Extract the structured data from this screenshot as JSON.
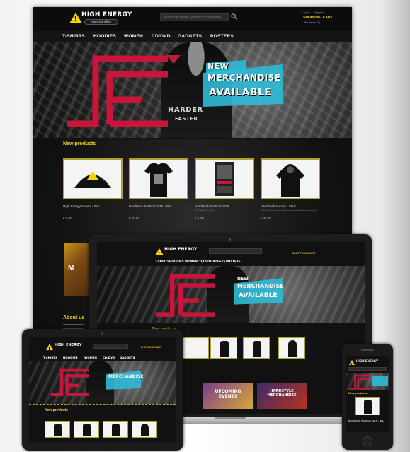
{
  "brand": {
    "name": "HIGH ENERGY",
    "tagline": "merchandise"
  },
  "header": {
    "search_placeholder": "Search by brand, product or keyword",
    "login": "Log in",
    "register": "Register",
    "cart_label": "SHOPPING CART",
    "cart_count": "No items (0)"
  },
  "nav": {
    "items": [
      "T-SHIRTS",
      "HOODIES",
      "WOMEN",
      "CD/DVD",
      "GADGETS",
      "POSTERS"
    ]
  },
  "banner": {
    "headline_line1": "NEW",
    "headline_line2": "MERCHANDISE",
    "headline_line3": "AVAILABLE",
    "shirt_line1": "HARDER",
    "shirt_line2": "FASTER"
  },
  "new_products": {
    "title": "New products",
    "items": [
      {
        "name": "High Energy Events - Fan",
        "description": "",
        "price": "€ 5,00",
        "icon": "fan-icon"
      },
      {
        "name": "Hardstock Festival 2015 - Tee",
        "description": "",
        "price": "€ 20,00",
        "icon": "tshirt-icon"
      },
      {
        "name": "Hardstock Festival 2015",
        "description": "A2 Official Poster",
        "price": "€ 5,00",
        "icon": "poster-icon"
      },
      {
        "name": "Hardstock Hoodie - Skull",
        "description": "The skull on the hoodie is printed with the colors of ...",
        "price": "€ 45,00",
        "icon": "hoodie-icon"
      }
    ]
  },
  "about": {
    "title": "About us"
  },
  "promos": {
    "upcoming": "UPCOMING EVENTS",
    "hardstyle": "HARDSTYLE MERCHANDISE"
  },
  "colors": {
    "accent_yellow": "#f5d200",
    "logo_red": "#c8163a",
    "banner_cyan": "#2fb9d6",
    "background_dark": "#101010"
  }
}
